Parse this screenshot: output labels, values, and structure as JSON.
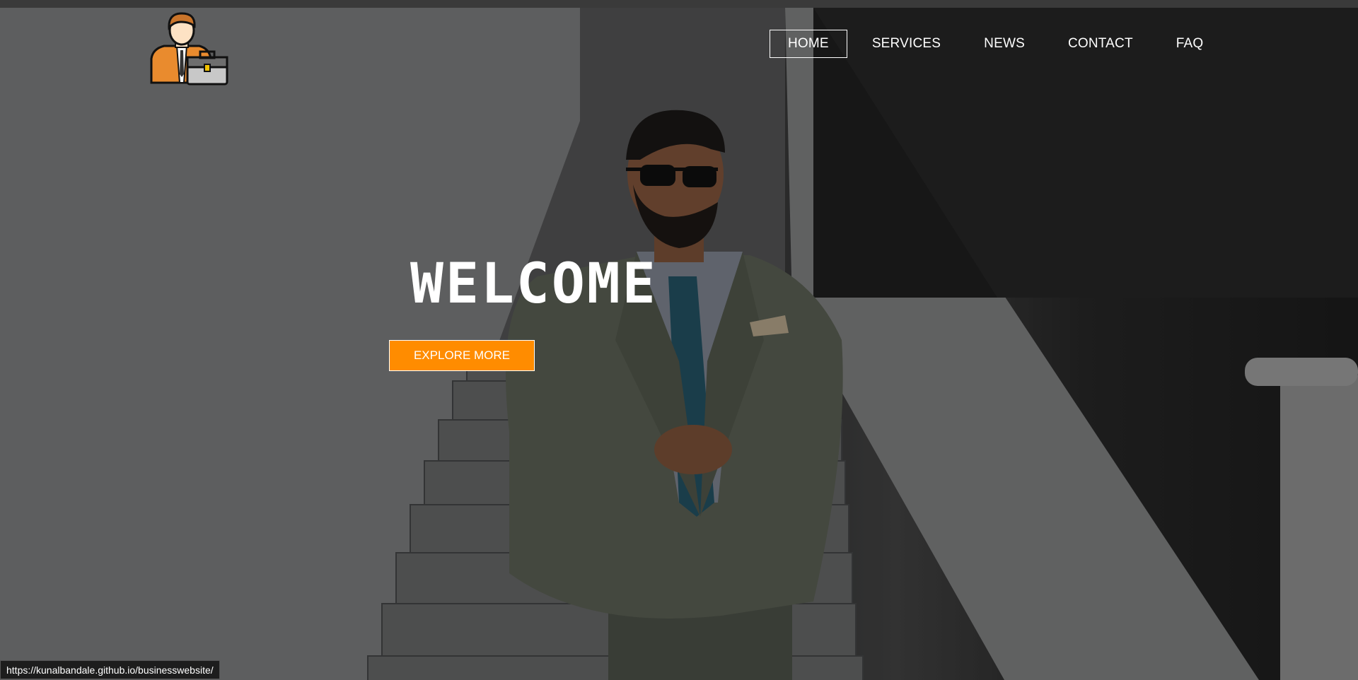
{
  "logo": {
    "icon": "businessman-briefcase-icon"
  },
  "nav": {
    "items": [
      "HOME",
      "SERVICES",
      "NEWS",
      "CONTACT",
      "FAQ"
    ],
    "active": "HOME"
  },
  "hero": {
    "title": "WELCOME",
    "cta_label": "EXPLORE MORE",
    "background": "businessman-on-staircase-photo"
  },
  "status_bar": {
    "url": "https://kunalbandale.github.io/businesswebsite/"
  },
  "colors": {
    "accent": "#ff8c00",
    "text": "#ffffff",
    "overlay": "#000000"
  }
}
